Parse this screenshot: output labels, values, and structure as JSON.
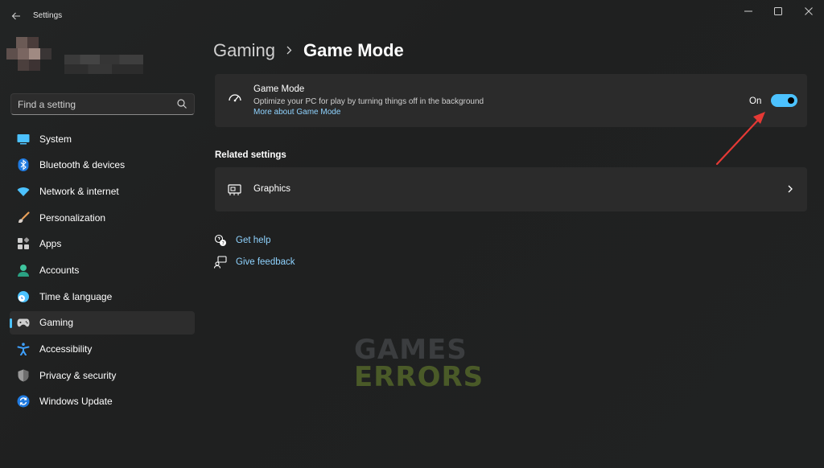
{
  "window": {
    "title": "Settings",
    "controls": [
      "minimize",
      "maximize",
      "close"
    ]
  },
  "search": {
    "placeholder": "Find a setting"
  },
  "sidebar": {
    "items": [
      {
        "label": "System",
        "icon": "system-icon",
        "color": "#4cc2ff"
      },
      {
        "label": "Bluetooth & devices",
        "icon": "bluetooth-icon",
        "color": "#1f7ae0"
      },
      {
        "label": "Network & internet",
        "icon": "wifi-icon",
        "color": "#4cc2ff"
      },
      {
        "label": "Personalization",
        "icon": "brush-icon",
        "color": "#e8a058"
      },
      {
        "label": "Apps",
        "icon": "apps-icon",
        "color": "#cfcfcf"
      },
      {
        "label": "Accounts",
        "icon": "account-icon",
        "color": "#3fc59e"
      },
      {
        "label": "Time & language",
        "icon": "globe-clock-icon",
        "color": "#4cc2ff"
      },
      {
        "label": "Gaming",
        "icon": "controller-icon",
        "color": "#cfcfcf",
        "active": true
      },
      {
        "label": "Accessibility",
        "icon": "accessibility-icon",
        "color": "#3ea0ff"
      },
      {
        "label": "Privacy & security",
        "icon": "shield-icon",
        "color": "#9a9a9a"
      },
      {
        "label": "Windows Update",
        "icon": "update-icon",
        "color": "#1f7ae0"
      }
    ]
  },
  "breadcrumb": {
    "parent": "Gaming",
    "current": "Game Mode"
  },
  "game_mode": {
    "title": "Game Mode",
    "description": "Optimize your PC for play by turning things off in the background",
    "link": "More about Game Mode",
    "state_label": "On",
    "enabled": true
  },
  "related": {
    "title": "Related settings",
    "graphics_label": "Graphics"
  },
  "help": {
    "get_help": "Get help",
    "give_feedback": "Give feedback"
  },
  "watermark": {
    "line1": "GAMES",
    "line2": "ERRORS"
  },
  "colors": {
    "accent": "#4cc2ff",
    "link": "#8fd3ff",
    "annotation_arrow": "#e53935",
    "card_bg": "#2b2b2b"
  }
}
